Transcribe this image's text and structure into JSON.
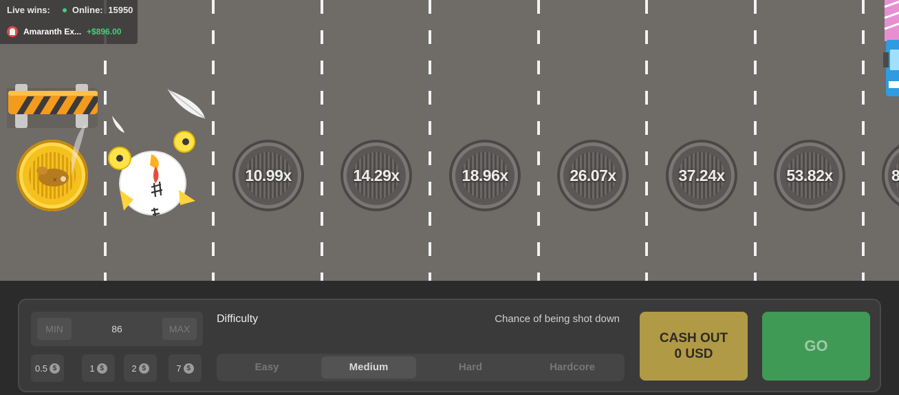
{
  "live_feed": {
    "live_wins_label": "Live wins:",
    "online_label": "Online:",
    "online_count": "15950",
    "latest_win": {
      "player": "Amaranth Ex...",
      "amount": "+$896.00"
    }
  },
  "road": {
    "multipliers": [
      "10.99x",
      "14.29x",
      "18.96x",
      "26.07x",
      "37.24x",
      "53.82x",
      "8"
    ]
  },
  "controls": {
    "bet": {
      "min_label": "MIN",
      "value": "86",
      "max_label": "MAX"
    },
    "quick_bets": [
      "0.5",
      "1",
      "2",
      "7"
    ],
    "currency_icon": "$",
    "difficulty_label": "Difficulty",
    "chance_label": "Chance of being shot down",
    "difficulty_options": [
      "Easy",
      "Medium",
      "Hard",
      "Hardcore"
    ],
    "selected_difficulty": "Medium",
    "cashout_line1": "CASH OUT",
    "cashout_line2": "0 USD",
    "go_label": "GO"
  },
  "colors": {
    "road": "#6f6b67",
    "win_green": "#3fd17a",
    "cashout_gold": "#b09a45",
    "go_green": "#3f9a55"
  }
}
